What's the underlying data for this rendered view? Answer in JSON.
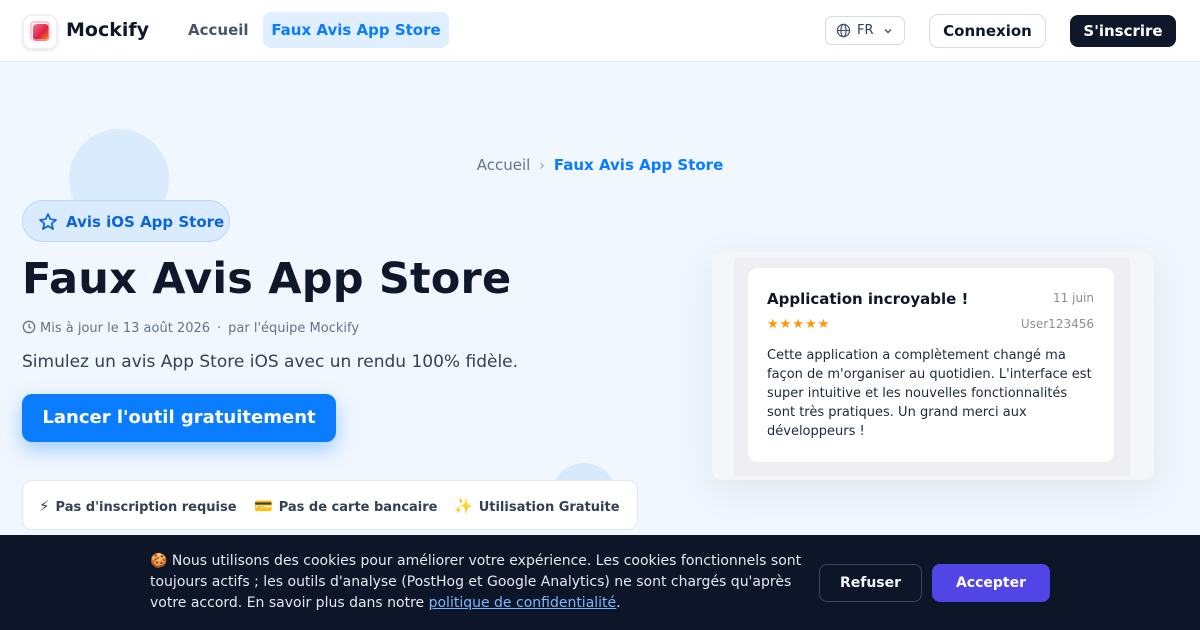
{
  "header": {
    "brand": "Mockify",
    "nav_home": "Accueil",
    "nav_active": "Faux Avis App Store",
    "language": "FR",
    "login_label": "Connexion",
    "signup_label": "S'inscrire"
  },
  "breadcrumb": {
    "home": "Accueil",
    "separator": "›",
    "current": "Faux Avis App Store"
  },
  "hero": {
    "badge": "Avis iOS App Store",
    "title": "Faux Avis App Store",
    "updated": "Mis à jour le 13 août 2026",
    "meta_separator": "·",
    "author": "par l'équipe Mockify",
    "subtitle": "Simulez un avis App Store iOS avec un rendu 100% fidèle.",
    "cta_label": "Lancer l'outil gratuitement"
  },
  "features": [
    {
      "emoji": "⚡",
      "label": "Pas d'inscription requise"
    },
    {
      "emoji": "💳",
      "label": "Pas de carte bancaire"
    },
    {
      "emoji": "✨",
      "label": "Utilisation Gratuite"
    }
  ],
  "review": {
    "title": "Application incroyable !",
    "date": "11 juin",
    "stars": "★★★★★",
    "rating": 5,
    "user": "User123456",
    "body": "Cette application a complètement changé ma façon de m'organiser au quotidien. L'interface est super intuitive et les nouvelles fonctionnalités sont très pratiques. Un grand merci aux développeurs !"
  },
  "cookie": {
    "emoji": "🍪",
    "text": "Nous utilisons des cookies pour améliorer votre expérience. Les cookies fonctionnels sont toujours actifs ; les outils d'analyse (PostHog et Google Analytics) ne sont chargés qu'après votre accord. En savoir plus dans notre",
    "link_label": "politique de confidentialité",
    "end": ".",
    "refuse_label": "Refuser",
    "accept_label": "Accepter"
  },
  "colors": {
    "accent": "#0a7cff",
    "dark": "#0f172a",
    "accept": "#5145e5",
    "star": "#ff9500"
  }
}
